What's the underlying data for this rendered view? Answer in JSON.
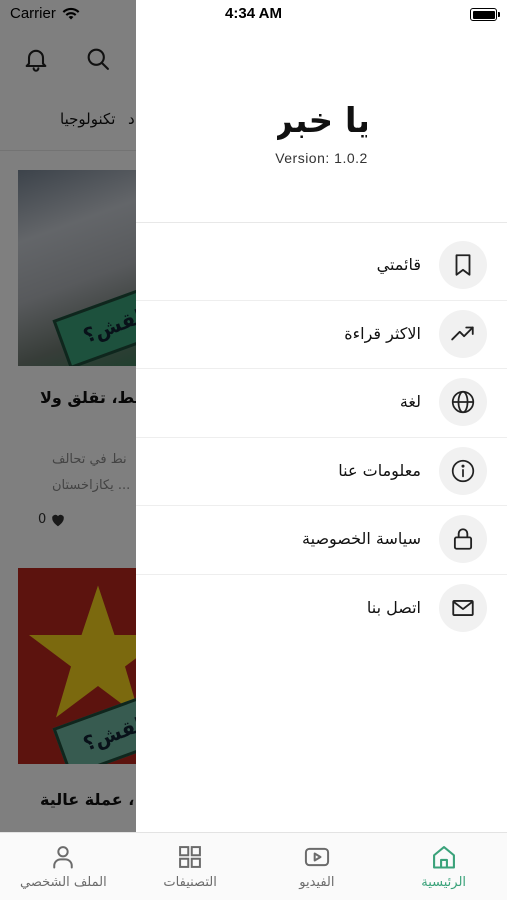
{
  "status_bar": {
    "carrier": "Carrier",
    "time": "4:34 AM"
  },
  "background": {
    "category_visible": "تكنولوجيا",
    "category_partial": "د",
    "article1_title_fragment": "النفط، تقلق ولا",
    "article1_excerpt_line1": "نط في تحالف",
    "article1_excerpt_line2": "يكازاخستان ...",
    "article1_likes": "0",
    "article1_stamp": "لقش؟",
    "article2_title_fragment": "عملة عالية ،",
    "article2_stamp": "لقش؟"
  },
  "drawer": {
    "logo_text": "يا خبر",
    "version": "Version: 1.0.2",
    "menu": [
      {
        "label": "قائمتي",
        "icon": "bookmark-icon"
      },
      {
        "label": "الاكثر قراءة",
        "icon": "trending-icon"
      },
      {
        "label": "لغة",
        "icon": "globe-icon"
      },
      {
        "label": "معلومات عنا",
        "icon": "info-icon"
      },
      {
        "label": "سياسة الخصوصية",
        "icon": "lock-icon"
      },
      {
        "label": "اتصل بنا",
        "icon": "mail-icon"
      }
    ]
  },
  "tabbar": {
    "tabs": [
      {
        "label": "الملف الشخصي",
        "icon": "person-icon",
        "active": false
      },
      {
        "label": "التصنيفات",
        "icon": "grid-icon",
        "active": false
      },
      {
        "label": "الفيديو",
        "icon": "video-icon",
        "active": false
      },
      {
        "label": "الرئيسية",
        "icon": "home-icon",
        "active": true
      }
    ]
  },
  "colors": {
    "accent": "#3aa27a",
    "overlay": "rgba(0,0,0,0.5)",
    "icon_bg": "#f1f1f1"
  }
}
